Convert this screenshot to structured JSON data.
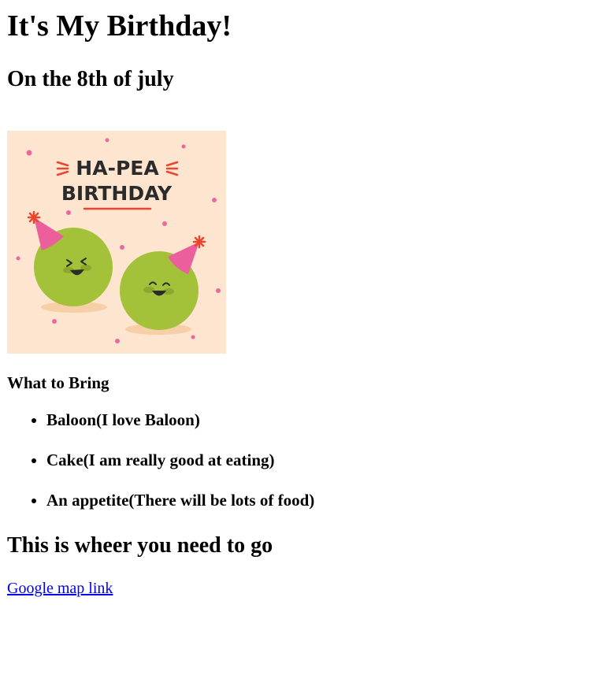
{
  "page": {
    "title": "It's My Birthday!",
    "subtitle": "On the 8th of july"
  },
  "card": {
    "line1": "HA-PEA",
    "line2": "BIRTHDAY",
    "colors": {
      "background": "#fde5cf",
      "pea": "#a4c13a",
      "hat": "#ec5f9d",
      "accent": "#e8462e",
      "text": "#2b2b2b"
    },
    "icons": [
      "pea-character-icon",
      "party-hat-icon",
      "confetti-dot-icon"
    ]
  },
  "bring": {
    "heading": "What to Bring",
    "items": [
      "Baloon(I love Baloon)",
      "Cake(I am really good at eating)",
      "An appetite(There will be lots of food)"
    ]
  },
  "directions": {
    "heading": "This is wheer you need to go",
    "link_label": "Google map link"
  }
}
